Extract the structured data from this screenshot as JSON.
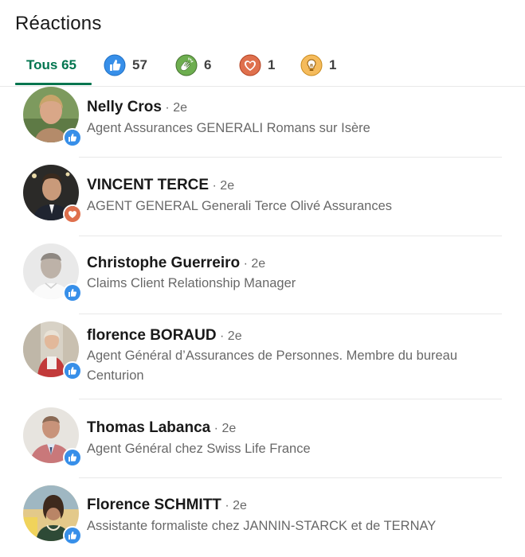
{
  "header": {
    "title": "Réactions"
  },
  "tabs": [
    {
      "label": "Tous 65",
      "icon": "all",
      "active": true
    },
    {
      "label": "57",
      "icon": "like-icon"
    },
    {
      "label": "6",
      "icon": "celebrate-icon"
    },
    {
      "label": "1",
      "icon": "love-icon"
    },
    {
      "label": "1",
      "icon": "insightful-icon"
    }
  ],
  "people": [
    {
      "name": "Nelly Cros",
      "degree": "2e",
      "headline": "Agent Assurances GENERALI Romans sur Isère",
      "reaction": "like-icon"
    },
    {
      "name": "VINCENT TERCE",
      "degree": "2e",
      "headline": "AGENT GENERAL Generali Terce Olivé Assurances",
      "reaction": "love-icon"
    },
    {
      "name": "Christophe Guerreiro",
      "degree": "2e",
      "headline": "Claims Client Relationship Manager",
      "reaction": "like-icon"
    },
    {
      "name": "florence BORAUD",
      "degree": "2e",
      "headline": "Agent Général d’Assurances de Personnes. Membre du bureau Centurion",
      "reaction": "like-icon"
    },
    {
      "name": "Thomas Labanca",
      "degree": "2e",
      "headline": "Agent Général chez Swiss Life France",
      "reaction": "like-icon"
    },
    {
      "name": "Florence SCHMITT",
      "degree": "2e",
      "headline": "Assistante formaliste chez JANNIN-STARCK et de TERNAY",
      "reaction": "like-icon"
    }
  ],
  "colors": {
    "accent": "#01754f",
    "like": "#378fe9",
    "celebrate": "#44712e",
    "love": "#df704d",
    "insightful": "#f5bb5c"
  }
}
